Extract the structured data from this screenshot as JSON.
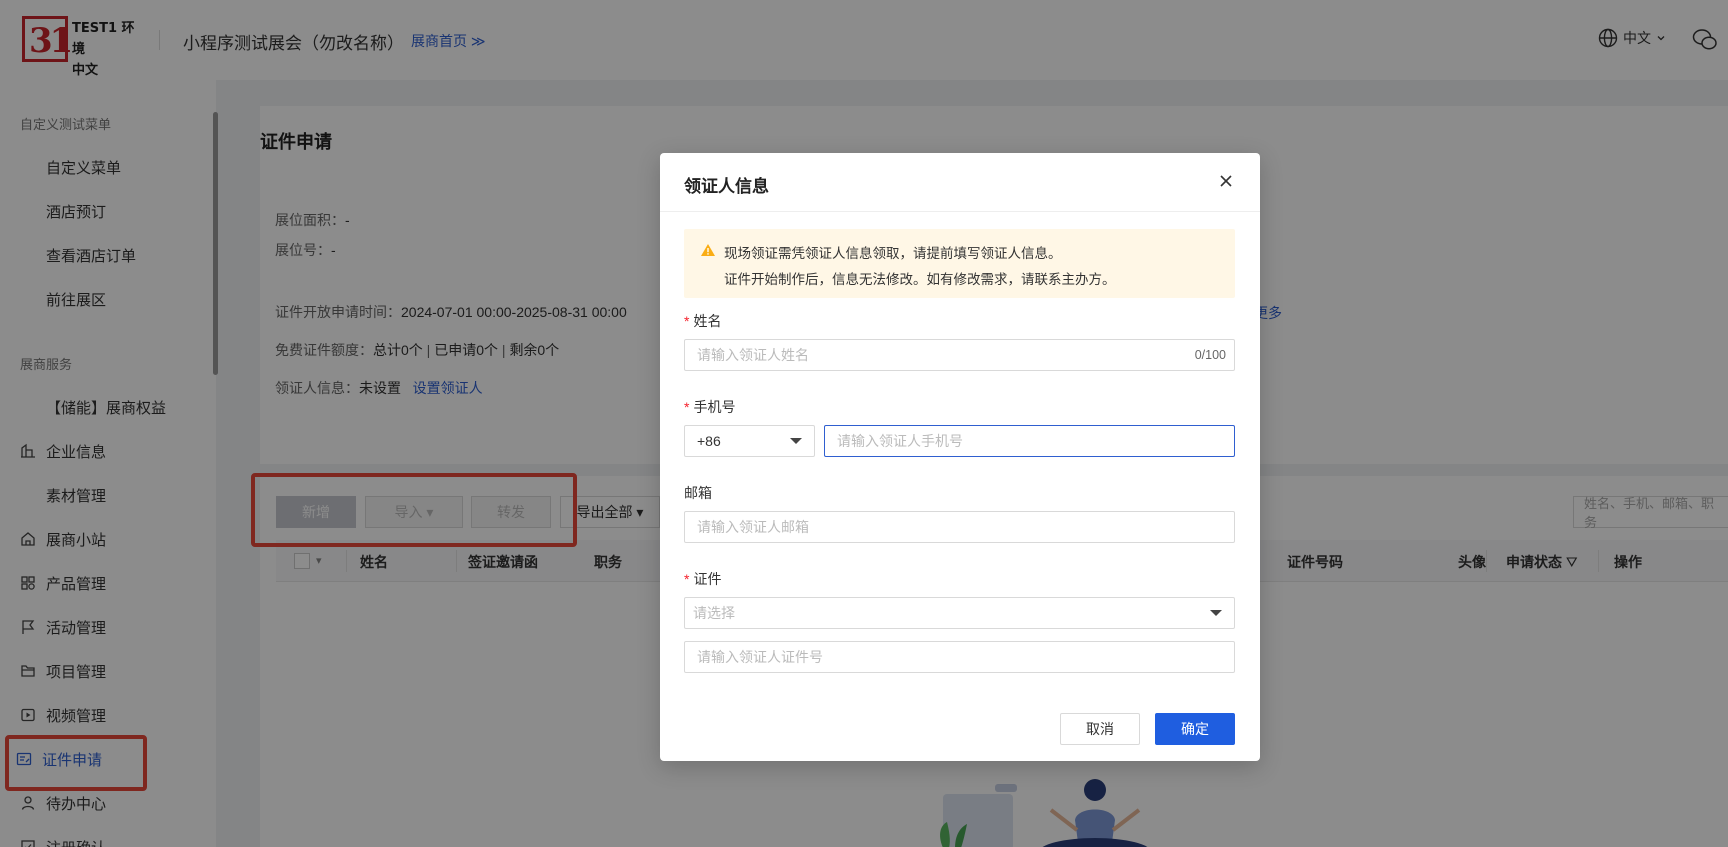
{
  "header": {
    "logo_text_line1": "TEST1 环境",
    "logo_text_line2": "中文 LOGO",
    "logo_mark": "31",
    "title": "小程序测试展会（勿改名称）",
    "home_link": "展商首页 ≫",
    "language": "中文"
  },
  "sidebar": {
    "group1": "自定义测试菜单",
    "group1_items": [
      "自定义菜单",
      "酒店预订",
      "查看酒店订单",
      "前往展区"
    ],
    "group2": "展商服务",
    "group2_items": [
      {
        "label": "【储能】展商权益",
        "icon": ""
      },
      {
        "label": "企业信息",
        "icon": "building-icon"
      },
      {
        "label": "素材管理",
        "icon": ""
      },
      {
        "label": "展商小站",
        "icon": "home-icon"
      },
      {
        "label": "产品管理",
        "icon": "grid-icon"
      },
      {
        "label": "活动管理",
        "icon": "flag-icon"
      },
      {
        "label": "项目管理",
        "icon": "folder-icon"
      },
      {
        "label": "视频管理",
        "icon": "video-icon"
      },
      {
        "label": "证件申请",
        "icon": "id-card-icon",
        "active": true
      },
      {
        "label": "待办中心",
        "icon": "user-icon"
      },
      {
        "label": "注册确认",
        "icon": "check-icon"
      }
    ]
  },
  "main": {
    "title": "证件申请",
    "booth_area_label": "展位面积：",
    "booth_area_value": "-",
    "booth_no_label": "展位号：",
    "booth_no_value": "-",
    "open_time_label": "证件开放申请时间：",
    "open_time_value": "2024-07-01 00:00-2025-08-31 00:00",
    "more_link": "更多",
    "quota_label": "免费证件额度：",
    "quota_total": "总计0个",
    "quota_applied": "已申请0个",
    "quota_remaining": "剩余0个",
    "collector_label": "领证人信息：",
    "collector_value": "未设置",
    "collector_link": "设置领证人",
    "toolbar": {
      "add": "新增",
      "import": "导入",
      "forward": "转发",
      "export_all": "导出全部"
    },
    "search_placeholder": "姓名、手机、邮箱、职务",
    "columns": [
      "姓名",
      "签证邀请函",
      "职务",
      "证件号码",
      "头像",
      "申请状态",
      "操作"
    ]
  },
  "modal": {
    "title": "领证人信息",
    "notice_line1": "现场领证需凭领证人信息领取，请提前填写领证人信息。",
    "notice_line2": "证件开始制作后，信息无法修改。如有修改需求，请联系主办方。",
    "name_label": "姓名",
    "name_placeholder": "请输入领证人姓名",
    "name_count": "0/100",
    "phone_label": "手机号",
    "phone_code": "+86",
    "phone_placeholder": "请输入领证人手机号",
    "email_label": "邮箱",
    "email_placeholder": "请输入领证人邮箱",
    "cert_label": "证件",
    "cert_type_placeholder": "请选择",
    "cert_no_placeholder": "请输入领证人证件号",
    "cancel": "取消",
    "confirm": "确定"
  },
  "colors": {
    "accent": "#1f5ee0",
    "highlight_box": "#e8473a",
    "notice_bg": "#fff7e6",
    "warning": "#faad14"
  }
}
